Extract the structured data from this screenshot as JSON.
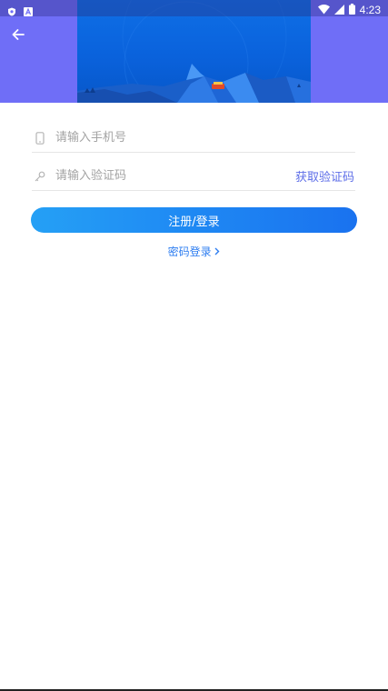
{
  "status_bar": {
    "time": "4:23",
    "left_icons": [
      "shield-icon",
      "a-badge-icon"
    ],
    "right_icons": [
      "wifi-icon",
      "signal-icon",
      "battery-icon"
    ]
  },
  "header": {
    "back_icon": "arrow-left-icon",
    "background_color": "#6f6ef7",
    "banner_color": "#0a62dc"
  },
  "form": {
    "phone": {
      "placeholder": "请输入手机号",
      "value": "",
      "icon": "phone-icon"
    },
    "code": {
      "placeholder": "请输入验证码",
      "value": "",
      "icon": "key-icon"
    },
    "get_code_label": "获取验证码",
    "submit_label": "注册/登录",
    "password_login_label": "密码登录",
    "password_login_icon": "chevron-right-icon"
  },
  "colors": {
    "accent": "#1e86f3",
    "link": "#5e6ee8",
    "placeholder": "#a3a3a3"
  }
}
